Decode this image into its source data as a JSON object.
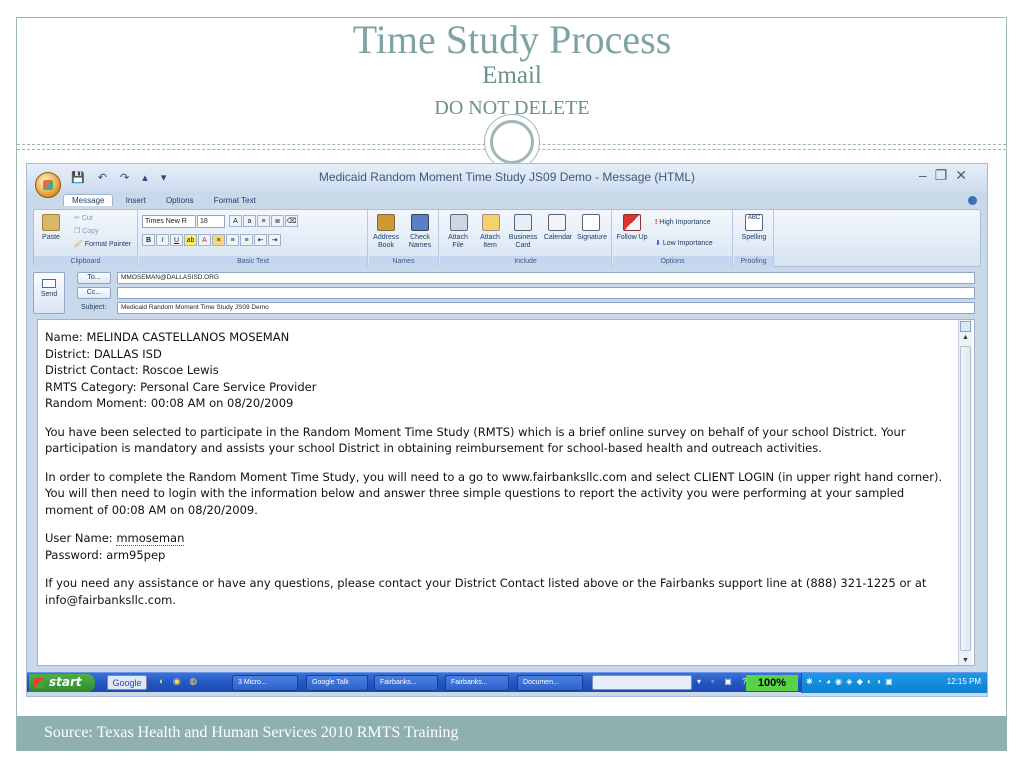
{
  "slide": {
    "title": "Time Study Process",
    "subtitle": "Email",
    "subtitle2": "DO NOT DELETE",
    "source": "Source: Texas Health and Human Services 2010 RMTS Training"
  },
  "window": {
    "title": "Medicaid Random Moment Time Study JS09 Demo - Message (HTML)",
    "qat_icons": [
      "save-icon",
      "undo-icon",
      "redo-icon",
      "up-arrow-icon",
      "down-arrow-icon"
    ],
    "controls": [
      "minimize",
      "restore",
      "close"
    ]
  },
  "ribbon": {
    "tabs": [
      "Message",
      "Insert",
      "Options",
      "Format Text"
    ],
    "active_tab": "Message",
    "clipboard": {
      "paste": "Paste",
      "cut": "Cut",
      "copy": "Copy",
      "format_painter": "Format Painter",
      "label": "Clipboard"
    },
    "basic_text": {
      "font": "Times New R",
      "size": "18",
      "label": "Basic Text"
    },
    "names": {
      "address_book": "Address Book",
      "check_names": "Check Names",
      "label": "Names"
    },
    "include": {
      "attach_file": "Attach File",
      "attach_item": "Attach Item",
      "business_card": "Business Card",
      "calendar": "Calendar",
      "signature": "Signature",
      "label": "Include"
    },
    "options": {
      "follow_up": "Follow Up",
      "high_importance": "High Importance",
      "low_importance": "Low Importance",
      "label": "Options"
    },
    "proofing": {
      "spelling": "Spelling",
      "label": "Proofing"
    }
  },
  "header": {
    "send": "Send",
    "to_button": "To...",
    "cc_button": "Cc...",
    "subject_label": "Subject:",
    "to_value": "MMOSEMAN@DALLASISD.ORG",
    "cc_value": "",
    "subject_value": "Medicaid Random Moment Time Study JS09 Demo"
  },
  "body": {
    "name_line": "Name:  MELINDA CASTELLANOS MOSEMAN",
    "district_line": "District:  DALLAS ISD",
    "contact_line": "District Contact:  Roscoe Lewis",
    "category_line": "RMTS Category:  Personal Care Service Provider",
    "moment_line": "Random Moment:  00:08 AM on 08/20/2009",
    "para1": "You have been selected to participate in the Random Moment Time Study (RMTS) which is a brief online survey on behalf of your school District. Your participation is mandatory and assists your school District in obtaining reimbursement for school-based health and outreach activities.",
    "para2": "In order to complete the Random Moment Time Study, you will need to a go to www.fairbanksllc.com and select CLIENT LOGIN (in upper right hand corner). You will then need to login with the information below and answer three simple questions to report the activity you were performing at your sampled moment of 00:08 AM on 08/20/2009.",
    "username_label": "User Name: ",
    "username_value": "mmoseman",
    "password_line": "Password:  arm95pep",
    "para3": "If you need any assistance or have any questions, please contact your District Contact listed above or the Fairbanks support line at (888) 321-1225 or at info@fairbanksllc.com."
  },
  "taskbar": {
    "start": "start",
    "google": "Google",
    "tasks": [
      "3 Micro...",
      "Google Talk",
      "Fairbanks...",
      "Fairbanks...",
      "Documen..."
    ],
    "zoom": "100%",
    "clock": "12:15 PM"
  }
}
